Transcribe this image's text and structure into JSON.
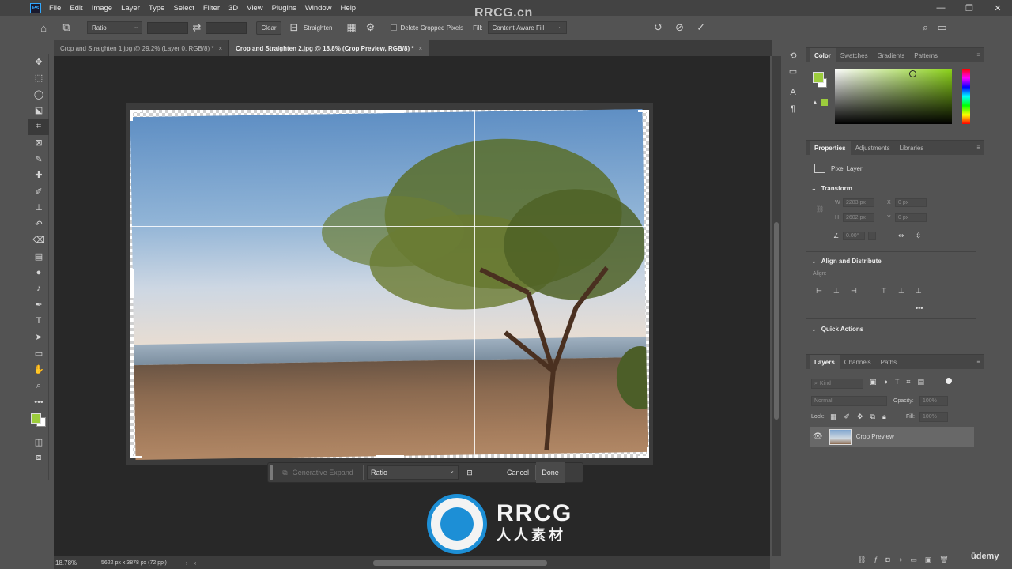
{
  "menu": {
    "logo": "Ps",
    "items": [
      "File",
      "Edit",
      "Image",
      "Layer",
      "Type",
      "Select",
      "Filter",
      "3D",
      "View",
      "Plugins",
      "Window",
      "Help"
    ]
  },
  "watermark_top": "RRCG.cn",
  "options": {
    "ratio": "Ratio",
    "clear": "Clear",
    "straighten": "Straighten",
    "delete_cropped": "Delete Cropped Pixels",
    "fill_label": "Fill:",
    "fill_value": "Content-Aware Fill"
  },
  "tabs": [
    {
      "label": "Crop and Straighten 1.jpg @ 29.2% (Layer 0, RGB/8) *",
      "close": "×"
    },
    {
      "label": "Crop and Straighten 2.jpg @ 18.8% (Crop Preview, RGB/8) *",
      "close": "×"
    }
  ],
  "taskbar": {
    "generative_expand": "Generative Expand",
    "ratio": "Ratio",
    "more": "···",
    "cancel": "Cancel",
    "done": "Done"
  },
  "status": {
    "zoom": "18.78%",
    "doc_info": "5622 px x 3878 px (72 ppi)"
  },
  "color_panel": {
    "tabs": [
      "Color",
      "Swatches",
      "Gradients",
      "Patterns"
    ],
    "fg_color": "#9ccc3c",
    "bg_color": "#ffffff"
  },
  "properties_panel": {
    "tabs": [
      "Properties",
      "Adjustments",
      "Libraries"
    ],
    "layer_type": "Pixel Layer",
    "transform_head": "Transform",
    "w_label": "W",
    "w_value": "2283 px",
    "x_label": "X",
    "x_value": "0 px",
    "h_label": "H",
    "h_value": "2602 px",
    "y_label": "Y",
    "y_value": "0 px",
    "angle_value": "0.00°",
    "align_head": "Align and Distribute",
    "align_label": "Align:",
    "align_more": "•••",
    "quick_actions": "Quick Actions"
  },
  "layers_panel": {
    "tabs": [
      "Layers",
      "Channels",
      "Paths"
    ],
    "kind": "Kind",
    "blend": "Normal",
    "opacity_label": "Opacity:",
    "opacity_value": "100%",
    "lock_label": "Lock:",
    "fill_label": "Fill:",
    "fill_value": "100%",
    "layer_name": "Crop Preview"
  },
  "watermark_bottom": {
    "line1": "RRCG",
    "line2": "人人素材"
  },
  "udemy": "ūdemy"
}
